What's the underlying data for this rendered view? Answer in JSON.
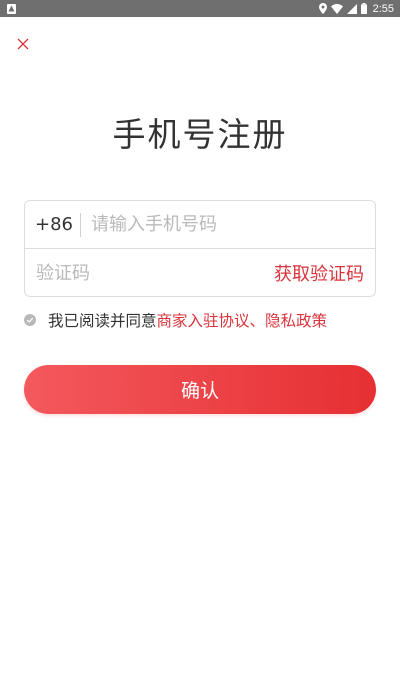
{
  "status_bar": {
    "time": "2:55",
    "icons": [
      "notification-icon",
      "location-icon",
      "wifi-icon",
      "cellular-icon",
      "battery-icon"
    ]
  },
  "close": {
    "icon": "close-icon",
    "color": "#d9343b"
  },
  "title": "手机号注册",
  "form": {
    "country_code": "+86",
    "phone_placeholder": "请输入手机号码",
    "code_placeholder": "验证码",
    "get_code_label": "获取验证码"
  },
  "agreement": {
    "prefix": "我已阅读并同意",
    "link1": "商家入驻协议",
    "separator": "、",
    "link2": "隐私政策",
    "checked": false
  },
  "confirm_label": "确认",
  "colors": {
    "accent": "#d9343b",
    "button_start": "#f3595d",
    "button_end": "#e62f33",
    "status_bar": "#6f6f6f"
  }
}
